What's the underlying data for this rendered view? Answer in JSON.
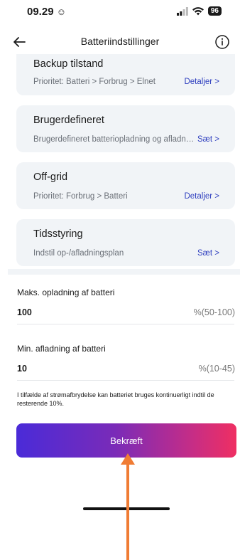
{
  "status_bar": {
    "time": "09.29",
    "emoji": "☺",
    "battery": "96"
  },
  "nav": {
    "title": "Batteriindstillinger"
  },
  "cards": [
    {
      "title": "Backup tilstand",
      "subtitle": "Prioritet: Batteri > Forbrug > Elnet",
      "link": "Detaljer >"
    },
    {
      "title": "Brugerdefineret",
      "subtitle": "Brugerdefineret batteriopladning og afladning",
      "link": "Sæt >"
    },
    {
      "title": "Off-grid",
      "subtitle": "Prioritet: Forbrug > Batteri",
      "link": "Detaljer >"
    },
    {
      "title": "Tidsstyring",
      "subtitle": "Indstil op-/afladningsplan",
      "link": "Sæt >"
    }
  ],
  "fields": {
    "max_charge": {
      "label": "Maks. opladning af batteri",
      "value": "100",
      "range": "%(50-100)"
    },
    "min_discharge": {
      "label": "Min. afladning af batteri",
      "value": "10",
      "range": "%(10-45)"
    }
  },
  "note": "I tilfælde af strømafbrydelse kan batteriet bruges kontinuerligt indtil de resterende 10%.",
  "confirm_label": "Bekræft",
  "colors": {
    "link": "#2f3fbf",
    "card_bg": "#f1f4f7",
    "gradient_start": "#4a2bd8",
    "gradient_end": "#ef2f62",
    "annotation_arrow": "#f07c34"
  }
}
